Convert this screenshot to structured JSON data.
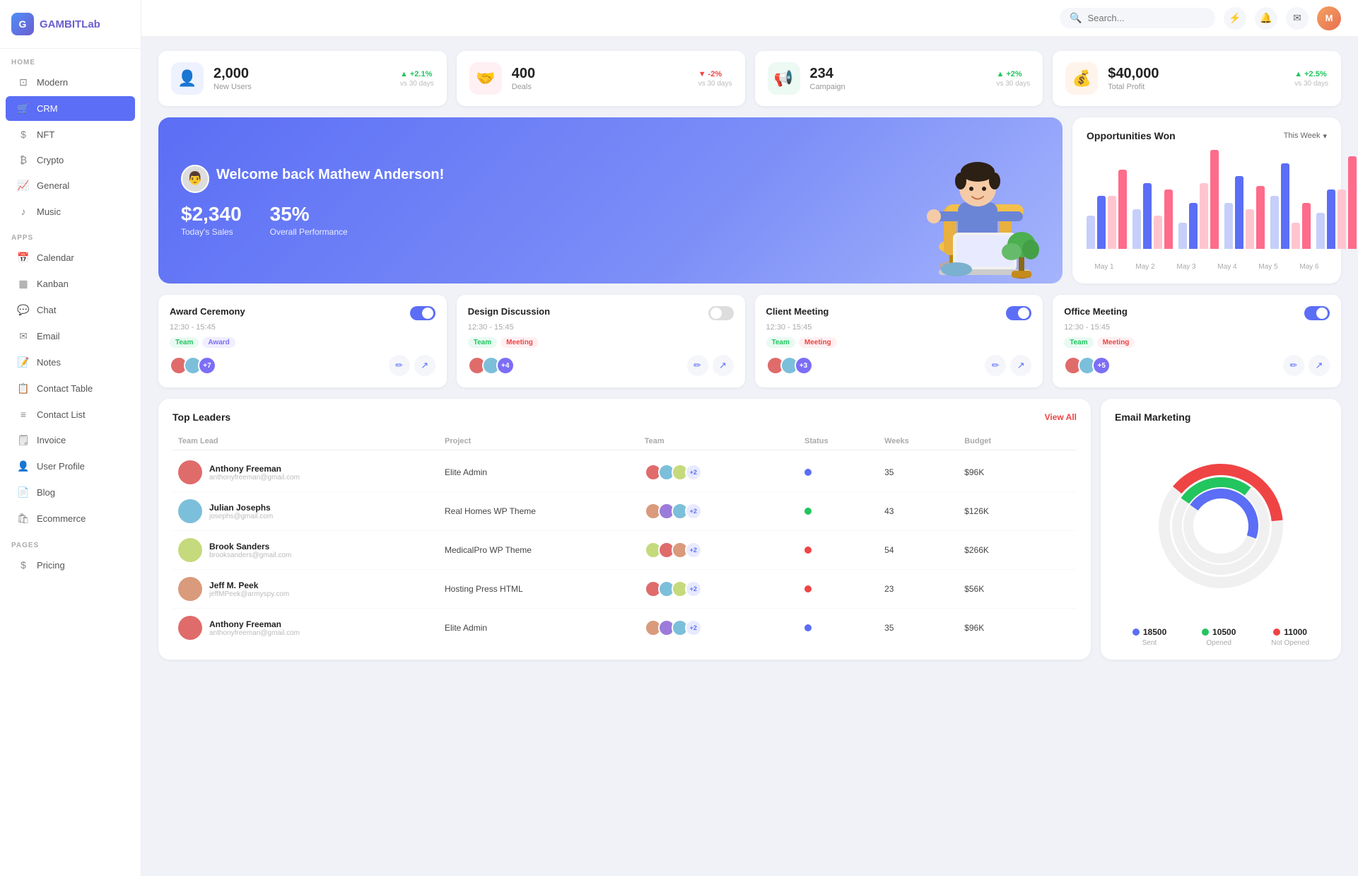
{
  "app": {
    "name": "GAMBIT",
    "name2": "Lab"
  },
  "header": {
    "search_placeholder": "Search...",
    "search_label": "Search"
  },
  "sidebar": {
    "section_home": "HOME",
    "section_apps": "APPS",
    "section_pages": "PAGES",
    "items_home": [
      {
        "id": "modern",
        "label": "Modern",
        "icon": "⊡"
      },
      {
        "id": "crm",
        "label": "CRM",
        "icon": "🛒",
        "active": true
      },
      {
        "id": "nft",
        "label": "NFT",
        "icon": "$"
      },
      {
        "id": "crypto",
        "label": "Crypto",
        "icon": "₿"
      },
      {
        "id": "general",
        "label": "General",
        "icon": "📈"
      },
      {
        "id": "music",
        "label": "Music",
        "icon": "♪"
      }
    ],
    "items_apps": [
      {
        "id": "calendar",
        "label": "Calendar",
        "icon": "📅"
      },
      {
        "id": "kanban",
        "label": "Kanban",
        "icon": "▦"
      },
      {
        "id": "chat",
        "label": "Chat",
        "icon": "💬"
      },
      {
        "id": "email",
        "label": "Email",
        "icon": "✉"
      },
      {
        "id": "notes",
        "label": "Notes",
        "icon": "📝"
      },
      {
        "id": "contact-table",
        "label": "Contact Table",
        "icon": "📋"
      },
      {
        "id": "contact-list",
        "label": "Contact List",
        "icon": "≡"
      },
      {
        "id": "invoice",
        "label": "Invoice",
        "icon": "🗒"
      },
      {
        "id": "user-profile",
        "label": "User Profile",
        "icon": "👤"
      },
      {
        "id": "blog",
        "label": "Blog",
        "icon": "📄"
      },
      {
        "id": "ecommerce",
        "label": "Ecommerce",
        "icon": "🛍"
      }
    ],
    "items_pages": [
      {
        "id": "pricing",
        "label": "Pricing",
        "icon": "$"
      }
    ]
  },
  "stats": [
    {
      "value": "2,000",
      "label": "New Users",
      "change": "+2.1%",
      "change_dir": "up",
      "vs": "vs 30 days",
      "icon": "👤",
      "color": "blue"
    },
    {
      "value": "400",
      "label": "Deals",
      "change": "-2%",
      "change_dir": "down",
      "vs": "vs 30 days",
      "icon": "🤝",
      "color": "pink"
    },
    {
      "value": "234",
      "label": "Campaign",
      "change": "+2%",
      "change_dir": "up",
      "vs": "vs 30 days",
      "icon": "📢",
      "color": "green"
    },
    {
      "value": "$40,000",
      "label": "Total Profit",
      "change": "+2.5%",
      "change_dir": "up",
      "vs": "vs 30 days",
      "icon": "💰",
      "color": "orange"
    }
  ],
  "welcome": {
    "greeting": "Welcome back Mathew Anderson!",
    "sales_value": "$2,340",
    "sales_label": "Today's Sales",
    "performance_value": "35%",
    "performance_label": "Overall Performance"
  },
  "chart": {
    "title": "Opportunities Won",
    "filter": "This Week",
    "labels": [
      "May 1",
      "May 2",
      "May 3",
      "May 4",
      "May 5",
      "May 6"
    ],
    "bars": [
      {
        "blue": 80,
        "blue_light": 50,
        "red": 120,
        "red_light": 80
      },
      {
        "blue": 100,
        "blue_light": 60,
        "red": 90,
        "red_light": 50
      },
      {
        "blue": 70,
        "blue_light": 40,
        "red": 150,
        "red_light": 100
      },
      {
        "blue": 110,
        "blue_light": 70,
        "red": 95,
        "red_light": 60
      },
      {
        "blue": 130,
        "blue_light": 80,
        "red": 70,
        "red_light": 40
      },
      {
        "blue": 90,
        "blue_light": 55,
        "red": 140,
        "red_light": 90
      }
    ]
  },
  "events": [
    {
      "title": "Award Ceremony",
      "time": "12:30 - 15:45",
      "tags": [
        "Team",
        "Award"
      ],
      "tag_colors": [
        "green",
        "purple"
      ],
      "toggle": "on",
      "count": "+7"
    },
    {
      "title": "Design Discussion",
      "time": "12:30 - 15:45",
      "tags": [
        "Team",
        "Meeting"
      ],
      "tag_colors": [
        "green",
        "red"
      ],
      "toggle": "off",
      "count": "+4"
    },
    {
      "title": "Client Meeting",
      "time": "12:30 - 15:45",
      "tags": [
        "Team",
        "Meeting"
      ],
      "tag_colors": [
        "green",
        "red"
      ],
      "toggle": "on",
      "count": "+3"
    },
    {
      "title": "Office Meeting",
      "time": "12:30 - 15:45",
      "tags": [
        "Team",
        "Meeting"
      ],
      "tag_colors": [
        "green",
        "red"
      ],
      "toggle": "on",
      "count": "+5"
    }
  ],
  "leaders": {
    "title": "Top Leaders",
    "view_all": "View All",
    "columns": [
      "Team Lead",
      "Project",
      "Team",
      "Status",
      "Weeks",
      "Budget"
    ],
    "rows": [
      {
        "name": "Anthony Freeman",
        "email": "anthonyfreeman@gmail.com",
        "project": "Elite Admin",
        "status": "blue",
        "weeks": "35",
        "budget": "$96K",
        "avatar_color": "#e06b6b"
      },
      {
        "name": "Julian Josephs",
        "email": "josephs@gmail.com",
        "project": "Real Homes WP Theme",
        "status": "green",
        "weeks": "43",
        "budget": "$126K",
        "avatar_color": "#7cbfda"
      },
      {
        "name": "Brook Sanders",
        "email": "brooksanders@gmail.com",
        "project": "MedicalPro WP Theme",
        "status": "red",
        "weeks": "54",
        "budget": "$266K",
        "avatar_color": "#c5da7c"
      },
      {
        "name": "Jeff M. Peek",
        "email": "jeffMPeek@armyspy.com",
        "project": "Hosting Press HTML",
        "status": "red",
        "weeks": "23",
        "budget": "$56K",
        "avatar_color": "#da9a7c"
      },
      {
        "name": "Anthony Freeman",
        "email": "anthonyfreeman@gmail.com",
        "project": "Elite Admin",
        "status": "blue",
        "weeks": "35",
        "budget": "$96K",
        "avatar_color": "#e06b6b"
      }
    ]
  },
  "email_marketing": {
    "title": "Email Marketing",
    "legend": [
      {
        "label": "Sent",
        "value": "18500",
        "color": "#5b6ef5"
      },
      {
        "label": "Opened",
        "value": "10500",
        "color": "#22c55e"
      },
      {
        "label": "Not Opened",
        "value": "11000",
        "color": "#ef4444"
      }
    ]
  }
}
